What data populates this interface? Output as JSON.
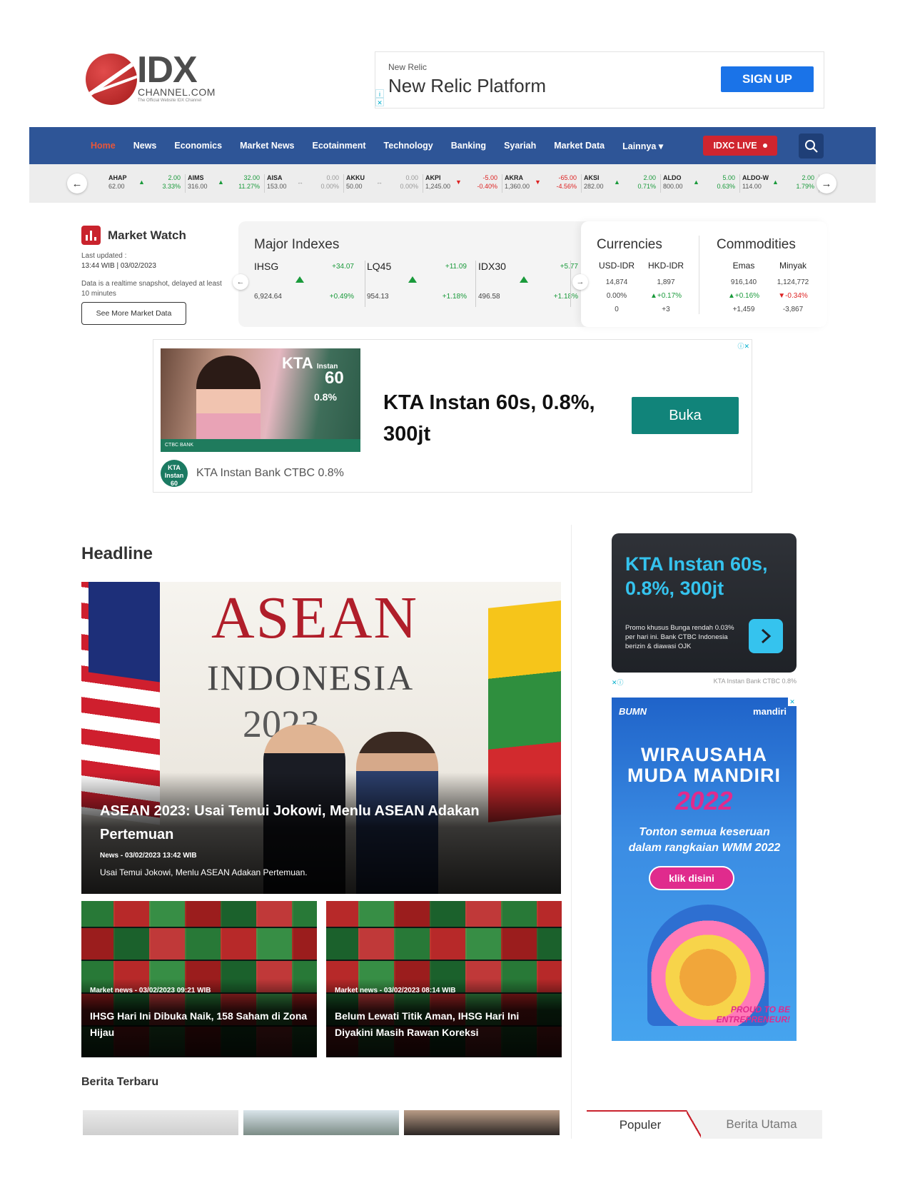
{
  "logo": {
    "brand": "IDX",
    "sub": "CHANNEL.COM",
    "tagline": "The Official Website IDX Channel"
  },
  "top_ad": {
    "advertiser": "New Relic",
    "headline": "New Relic Platform",
    "cta": "SIGN UP"
  },
  "nav": {
    "items": [
      "Home",
      "News",
      "Economics",
      "Market News",
      "Ecotainment",
      "Technology",
      "Banking",
      "Syariah",
      "Market Data",
      "Lainnya ▾"
    ],
    "live_label": "IDXC LIVE"
  },
  "ticker": [
    {
      "symbol": "AHAP",
      "price": "62.00",
      "change": "2.00",
      "pct": "3.33%",
      "dir": "up"
    },
    {
      "symbol": "AIMS",
      "price": "316.00",
      "change": "32.00",
      "pct": "11.27%",
      "dir": "up"
    },
    {
      "symbol": "AISA",
      "price": "153.00",
      "change": "0.00",
      "pct": "0.00%",
      "dir": "flat"
    },
    {
      "symbol": "AKKU",
      "price": "50.00",
      "change": "0.00",
      "pct": "0.00%",
      "dir": "flat"
    },
    {
      "symbol": "AKPI",
      "price": "1,245.00",
      "change": "-5.00",
      "pct": "-0.40%",
      "dir": "down"
    },
    {
      "symbol": "AKRA",
      "price": "1,360.00",
      "change": "-65.00",
      "pct": "-4.56%",
      "dir": "down"
    },
    {
      "symbol": "AKSI",
      "price": "282.00",
      "change": "2.00",
      "pct": "0.71%",
      "dir": "up"
    },
    {
      "symbol": "ALDO",
      "price": "800.00",
      "change": "5.00",
      "pct": "0.63%",
      "dir": "up"
    },
    {
      "symbol": "ALDO-W",
      "price": "114.00",
      "change": "2.00",
      "pct": "1.79%",
      "dir": "up"
    }
  ],
  "market_watch": {
    "title": "Market Watch",
    "updated_label": "Last updated :",
    "updated_time": "13:44 WIB | 03/02/2023",
    "note": "Data is a realtime snapshot, delayed at least 10 minutes",
    "button": "See More Market Data"
  },
  "major_indexes": {
    "title": "Major Indexes",
    "items": [
      {
        "name": "IHSG",
        "change": "+34.07",
        "value": "6,924.64",
        "pct": "+0.49%"
      },
      {
        "name": "LQ45",
        "change": "+11.09",
        "value": "954.13",
        "pct": "+1.18%"
      },
      {
        "name": "IDX30",
        "change": "+5.77",
        "value": "496.58",
        "pct": "+1.18%"
      }
    ]
  },
  "currencies": {
    "title": "Currencies",
    "cols": [
      {
        "name": "USD-IDR",
        "price": "14,874",
        "pct": "0.00%",
        "chg": "0"
      },
      {
        "name": "HKD-IDR",
        "price": "1,897",
        "pct": "▲+0.17%",
        "chg": "+3"
      }
    ]
  },
  "commodities": {
    "title": "Commodities",
    "cols": [
      {
        "name": "Emas",
        "price": "916,140",
        "pct": "▲+0.16%",
        "chg": "+1,459"
      },
      {
        "name": "Minyak",
        "price": "1,124,772",
        "pct": "▼-0.34%",
        "chg": "-3,867"
      }
    ]
  },
  "mid_ad": {
    "headline": "KTA Instan 60s, 0.8%, 300jt",
    "cta": "Buka",
    "footer": "KTA Instan Bank CTBC 0.8%",
    "image_kta": "KTA",
    "image_instan": "Instan",
    "image_60": "60",
    "image_rate": "0.8%",
    "image_footer": "CTBC BANK",
    "icon_text": "KTA Instan 60"
  },
  "headline": {
    "section_title": "Headline",
    "hero": {
      "sign_asean": "ASEAN",
      "sign_indonesia": "INDONESIA",
      "sign_year": "2023",
      "title": "ASEAN 2023: Usai Temui Jokowi, Menlu ASEAN Adakan Pertemuan",
      "meta": "News - 03/02/2023 13:42 WIB",
      "desc": "Usai Temui Jokowi, Menlu ASEAN Adakan Pertemuan."
    },
    "subs": [
      {
        "meta": "Market news - 03/02/2023 09:21 WIB",
        "title": "IHSG Hari Ini Dibuka Naik, 158 Saham di Zona Hijau"
      },
      {
        "meta": "Market news - 03/02/2023 08:14 WIB",
        "title": "Belum Lewati Titik Aman, IHSG Hari Ini Diyakini Masih Rawan Koreksi"
      }
    ]
  },
  "berita_terbaru": "Berita Terbaru",
  "right_ad1": {
    "headline": "KTA Instan 60s, 0.8%, 300jt",
    "desc": "Promo khusus Bunga rendah 0.03% per hari ini. Bank CTBC Indonesia berizin & diawasi OJK",
    "footer": "KTA Instan Bank CTBC 0.8%"
  },
  "right_ad2": {
    "left_brand": "BUMN",
    "right_brand": "mandiri",
    "line1": "WIRAUSAHA",
    "line2": "MUDA MANDIRI",
    "year": "2022",
    "tagline": "Tonton semua keseruan dalam rangkaian WMM 2022",
    "cta": "klik disini",
    "slogan": "PROUD TO BE ENTREPRENEUR!"
  },
  "tabs": [
    "Populer",
    "Berita Utama"
  ],
  "colors": {
    "nav": "#2e5597",
    "brand_red": "#c9232d",
    "up": "#1a9a3b",
    "down": "#dd2222",
    "ad_teal": "#11847a",
    "ad_cyan": "#35c3ee"
  }
}
